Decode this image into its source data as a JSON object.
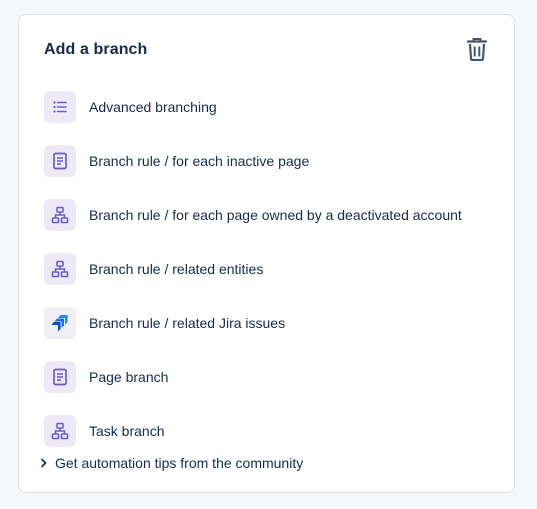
{
  "panel": {
    "title": "Add a branch",
    "delete_icon": "trash-icon"
  },
  "items": [
    {
      "label": "Advanced branching",
      "icon": "list-icon"
    },
    {
      "label": "Branch rule / for each inactive page",
      "icon": "page-icon"
    },
    {
      "label": "Branch rule / for each page owned by a deactivated account",
      "icon": "hierarchy-icon"
    },
    {
      "label": "Branch rule / related entities",
      "icon": "hierarchy-icon"
    },
    {
      "label": "Branch rule / related Jira issues",
      "icon": "jira-icon"
    },
    {
      "label": "Page branch",
      "icon": "page-icon"
    },
    {
      "label": "Task branch",
      "icon": "hierarchy-icon"
    }
  ],
  "footer": {
    "label": "Get automation tips from the community",
    "icon": "chevron-right-icon"
  },
  "colors": {
    "accent": "#6e5dc6",
    "icon_bg": "#ede9f6",
    "text": "#172b4d",
    "jira_blue": "#2684ff"
  }
}
